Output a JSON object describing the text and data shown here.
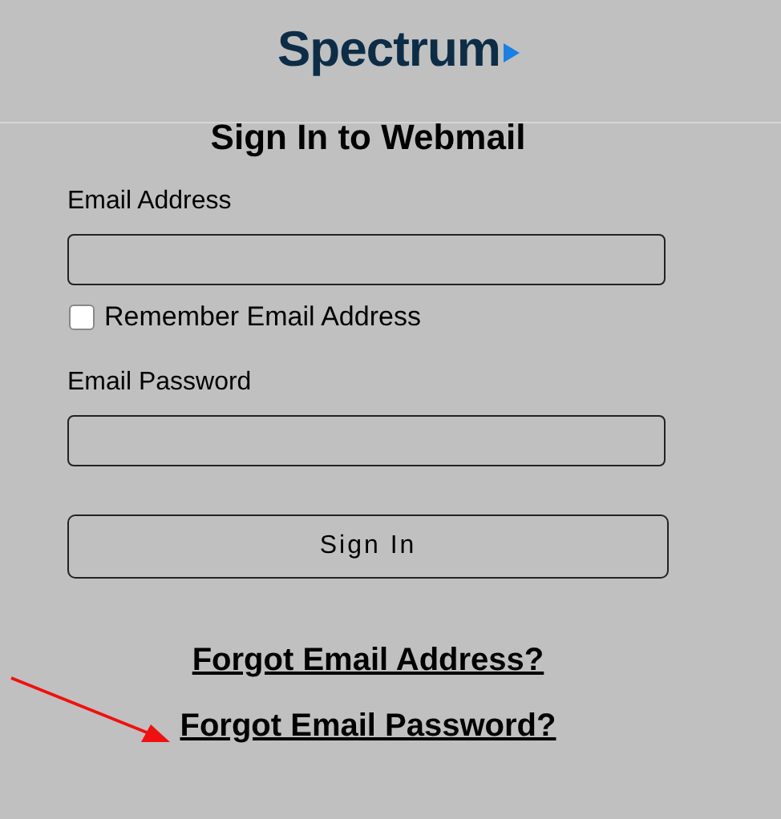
{
  "header": {
    "logo": "Spectrum"
  },
  "title": "Sign In to Webmail",
  "fields": [
    {
      "label": "Email Address"
    },
    {
      "label": "Email Password"
    }
  ],
  "remember": {
    "label": "Remember Email Address",
    "checked": false
  },
  "button": "Sign In",
  "links": [
    "Forgot Email Address?",
    "Forgot Email Password?"
  ]
}
